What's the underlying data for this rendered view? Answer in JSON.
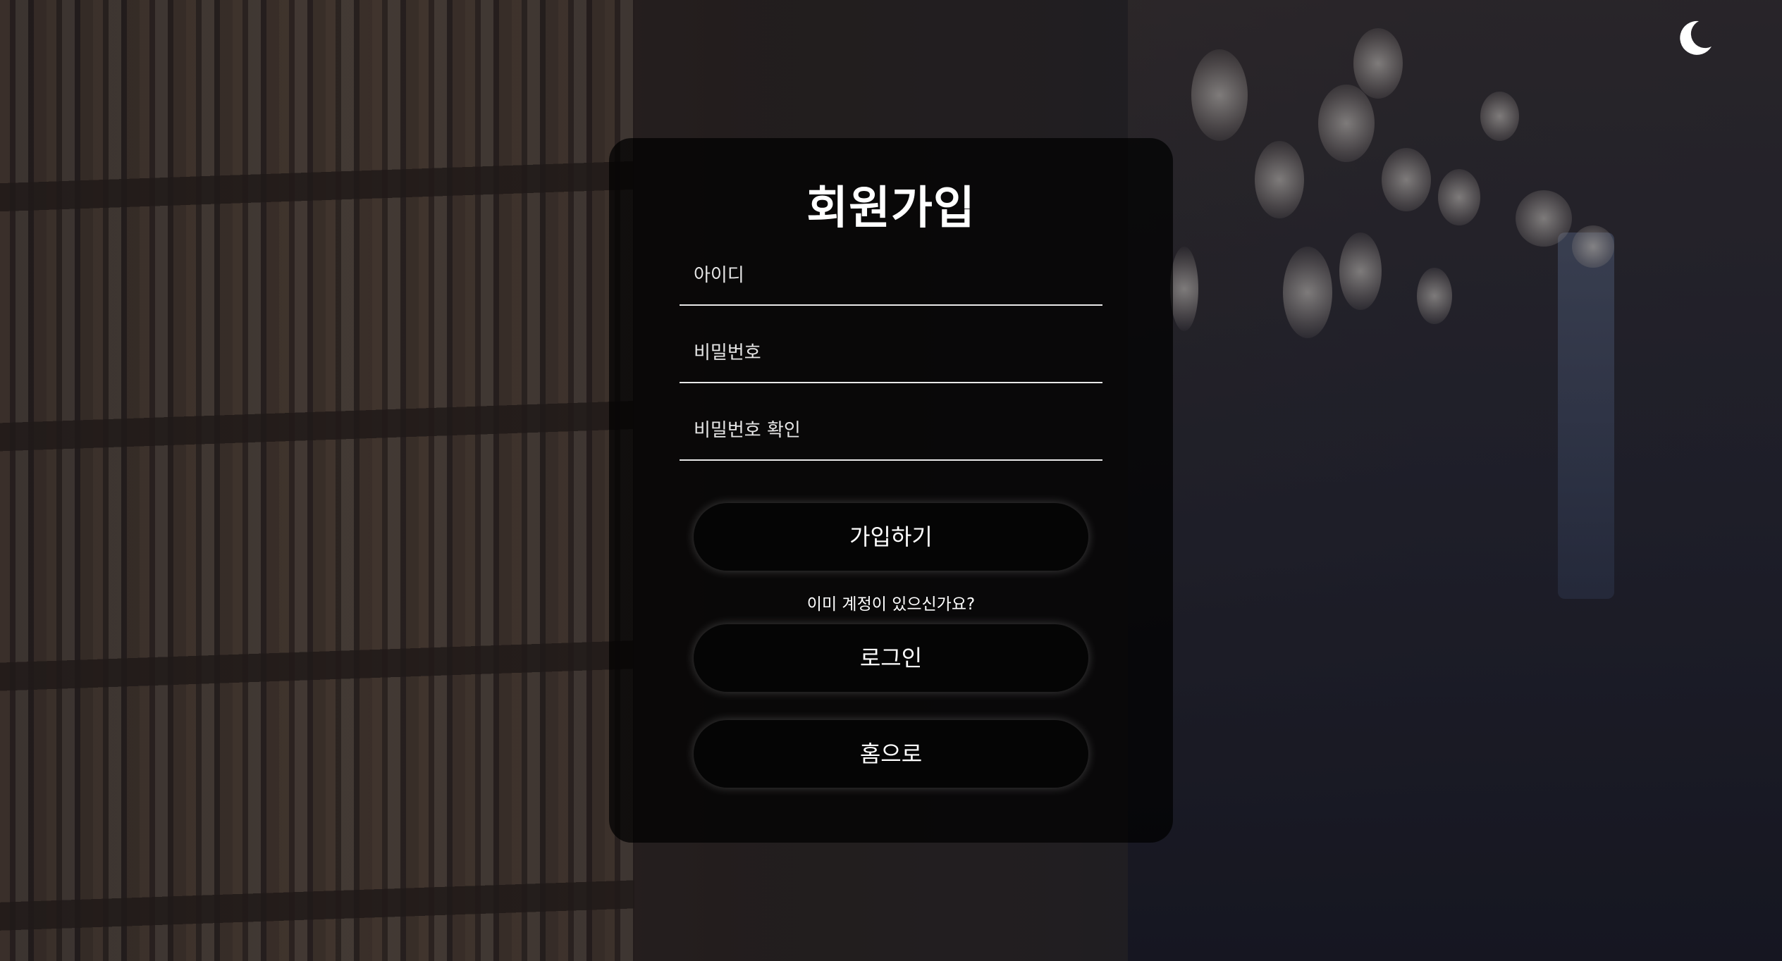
{
  "signup": {
    "title": "회원가입",
    "fields": {
      "username_placeholder": "아이디",
      "password_placeholder": "비밀번호",
      "password_confirm_placeholder": "비밀번호 확인"
    },
    "submit_label": "가입하기",
    "existing_account_prompt": "이미 계정이 있으신가요?",
    "login_label": "로그인",
    "home_label": "홈으로"
  },
  "header": {
    "theme_toggle_icon": "moon-icon"
  }
}
